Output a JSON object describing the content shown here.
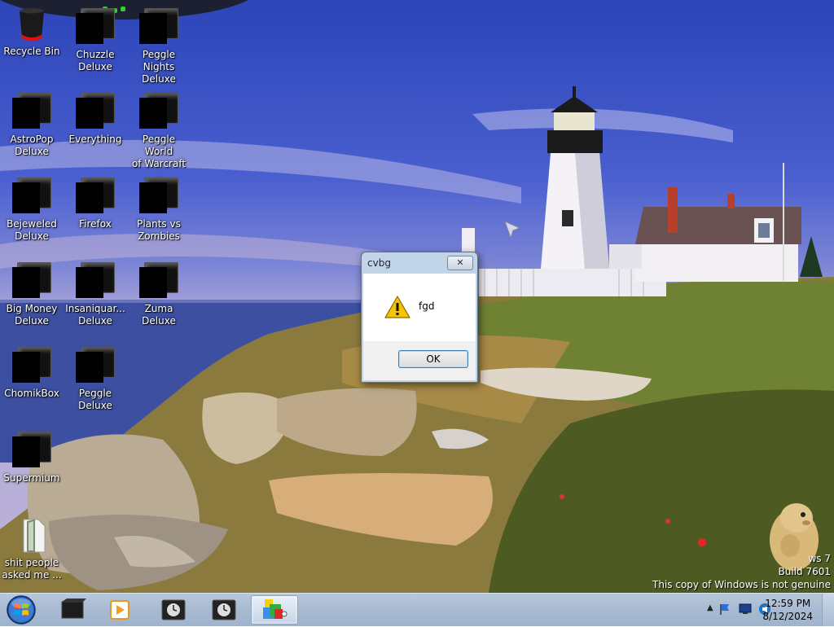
{
  "desktop": {
    "icons": [
      {
        "label": "Recycle Bin",
        "icon": "recycle-bin-icon"
      },
      {
        "label": "Chuzzle\nDeluxe",
        "icon": "chuzzle-deluxe-icon"
      },
      {
        "label": "Peggle Nights\nDeluxe",
        "icon": "peggle-nights-icon"
      },
      {
        "label": "AstroPop\nDeluxe",
        "icon": "astropop-icon"
      },
      {
        "label": "Everything",
        "icon": "everything-icon"
      },
      {
        "label": "Peggle World\nof Warcraft ...",
        "icon": "peggle-wow-icon"
      },
      {
        "label": "Bejeweled\nDeluxe",
        "icon": "bejeweled-icon"
      },
      {
        "label": "Firefox",
        "icon": "firefox-icon"
      },
      {
        "label": "Plants vs\nZombies",
        "icon": "plants-vs-zombies-icon"
      },
      {
        "label": "Big Money\nDeluxe",
        "icon": "big-money-icon"
      },
      {
        "label": "Insaniquar...\nDeluxe",
        "icon": "insaniquarium-icon"
      },
      {
        "label": "Zuma Deluxe",
        "icon": "zuma-icon"
      },
      {
        "label": "ChomikBox",
        "icon": "chomikbox-icon"
      },
      {
        "label": "Peggle Deluxe",
        "icon": "peggle-deluxe-icon"
      },
      {
        "label": "Supermium",
        "icon": "supermium-icon"
      },
      {
        "label": "shit people\nasked me ...",
        "icon": "text-file-icon"
      }
    ]
  },
  "dialog": {
    "title": "cvbg",
    "message": "fgd",
    "ok_label": "OK",
    "close_glyph": "✕",
    "icon": "warning-icon"
  },
  "watermark": {
    "line1": "ws 7",
    "line2": "Build 7601",
    "line3": "This copy of Windows is not genuine"
  },
  "taskbar": {
    "start_icon": "windows-orb-icon",
    "items": [
      {
        "icon": "black-box-app-icon",
        "active": false
      },
      {
        "icon": "media-player-icon",
        "active": false
      },
      {
        "icon": "clock-app-icon",
        "active": false
      },
      {
        "icon": "clock-app-icon",
        "active": false
      },
      {
        "icon": "colorful-shapes-app-icon",
        "active": true
      }
    ],
    "tray_icons": [
      "show-hidden-icons-arrow",
      "action-center-flag-icon",
      "network-icon",
      "volume-icon"
    ],
    "time": "12:59 PM",
    "date": "8/12/2024"
  }
}
